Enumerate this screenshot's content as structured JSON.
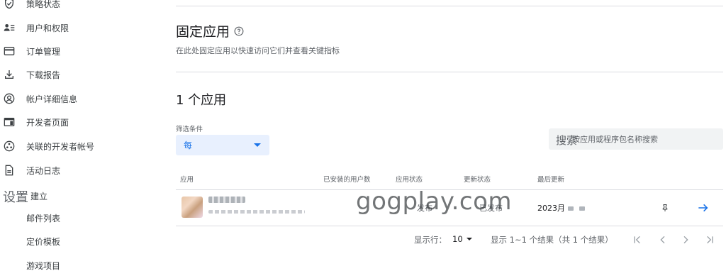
{
  "sidebar": {
    "items": [
      {
        "label": "策略状态",
        "icon": "shield-check-icon"
      },
      {
        "label": "用户和权限",
        "icon": "people-list-icon"
      },
      {
        "label": "订单管理",
        "icon": "card-icon"
      },
      {
        "label": "下载报告",
        "icon": "download-icon"
      },
      {
        "label": "帐户详细信息",
        "icon": "account-circle-icon"
      },
      {
        "label": "开发者页面",
        "icon": "web-page-icon"
      },
      {
        "label": "关联的开发者帐号",
        "icon": "linked-accounts-icon"
      },
      {
        "label": "活动日志",
        "icon": "document-icon"
      }
    ],
    "settings_heading": "设置",
    "settings_heading_tail": "建立",
    "settings_items": [
      {
        "label": "邮件列表"
      },
      {
        "label": "定价模板"
      },
      {
        "label": "游戏项目"
      }
    ]
  },
  "main": {
    "pinned_title": "固定应用",
    "pinned_desc": "在此处固定应用以快速访问它们并查看关键指标",
    "count_title": "1 个应用",
    "filter_label": "筛选条件",
    "filter_value": "每",
    "search_prefix": "搜索",
    "search_placeholder": "按应用或程序包名称搜索",
    "columns": [
      "应用",
      "已安装的用户数",
      "应用状态",
      "更新状态",
      "最后更新"
    ],
    "row": {
      "app_status": "发布",
      "update_status": "已发布",
      "last_updated": "2023月"
    },
    "footer": {
      "rows_label": "显示行：",
      "rows_value": "10",
      "results_text": "显示 1~1 个结果（共 1 个结果）"
    }
  },
  "watermark": "gogplay.com",
  "colors": {
    "accent": "#1a73e8",
    "filter_bg": "#e8f0fe",
    "search_bg": "#f1f3f4",
    "divider": "#dadce0"
  }
}
